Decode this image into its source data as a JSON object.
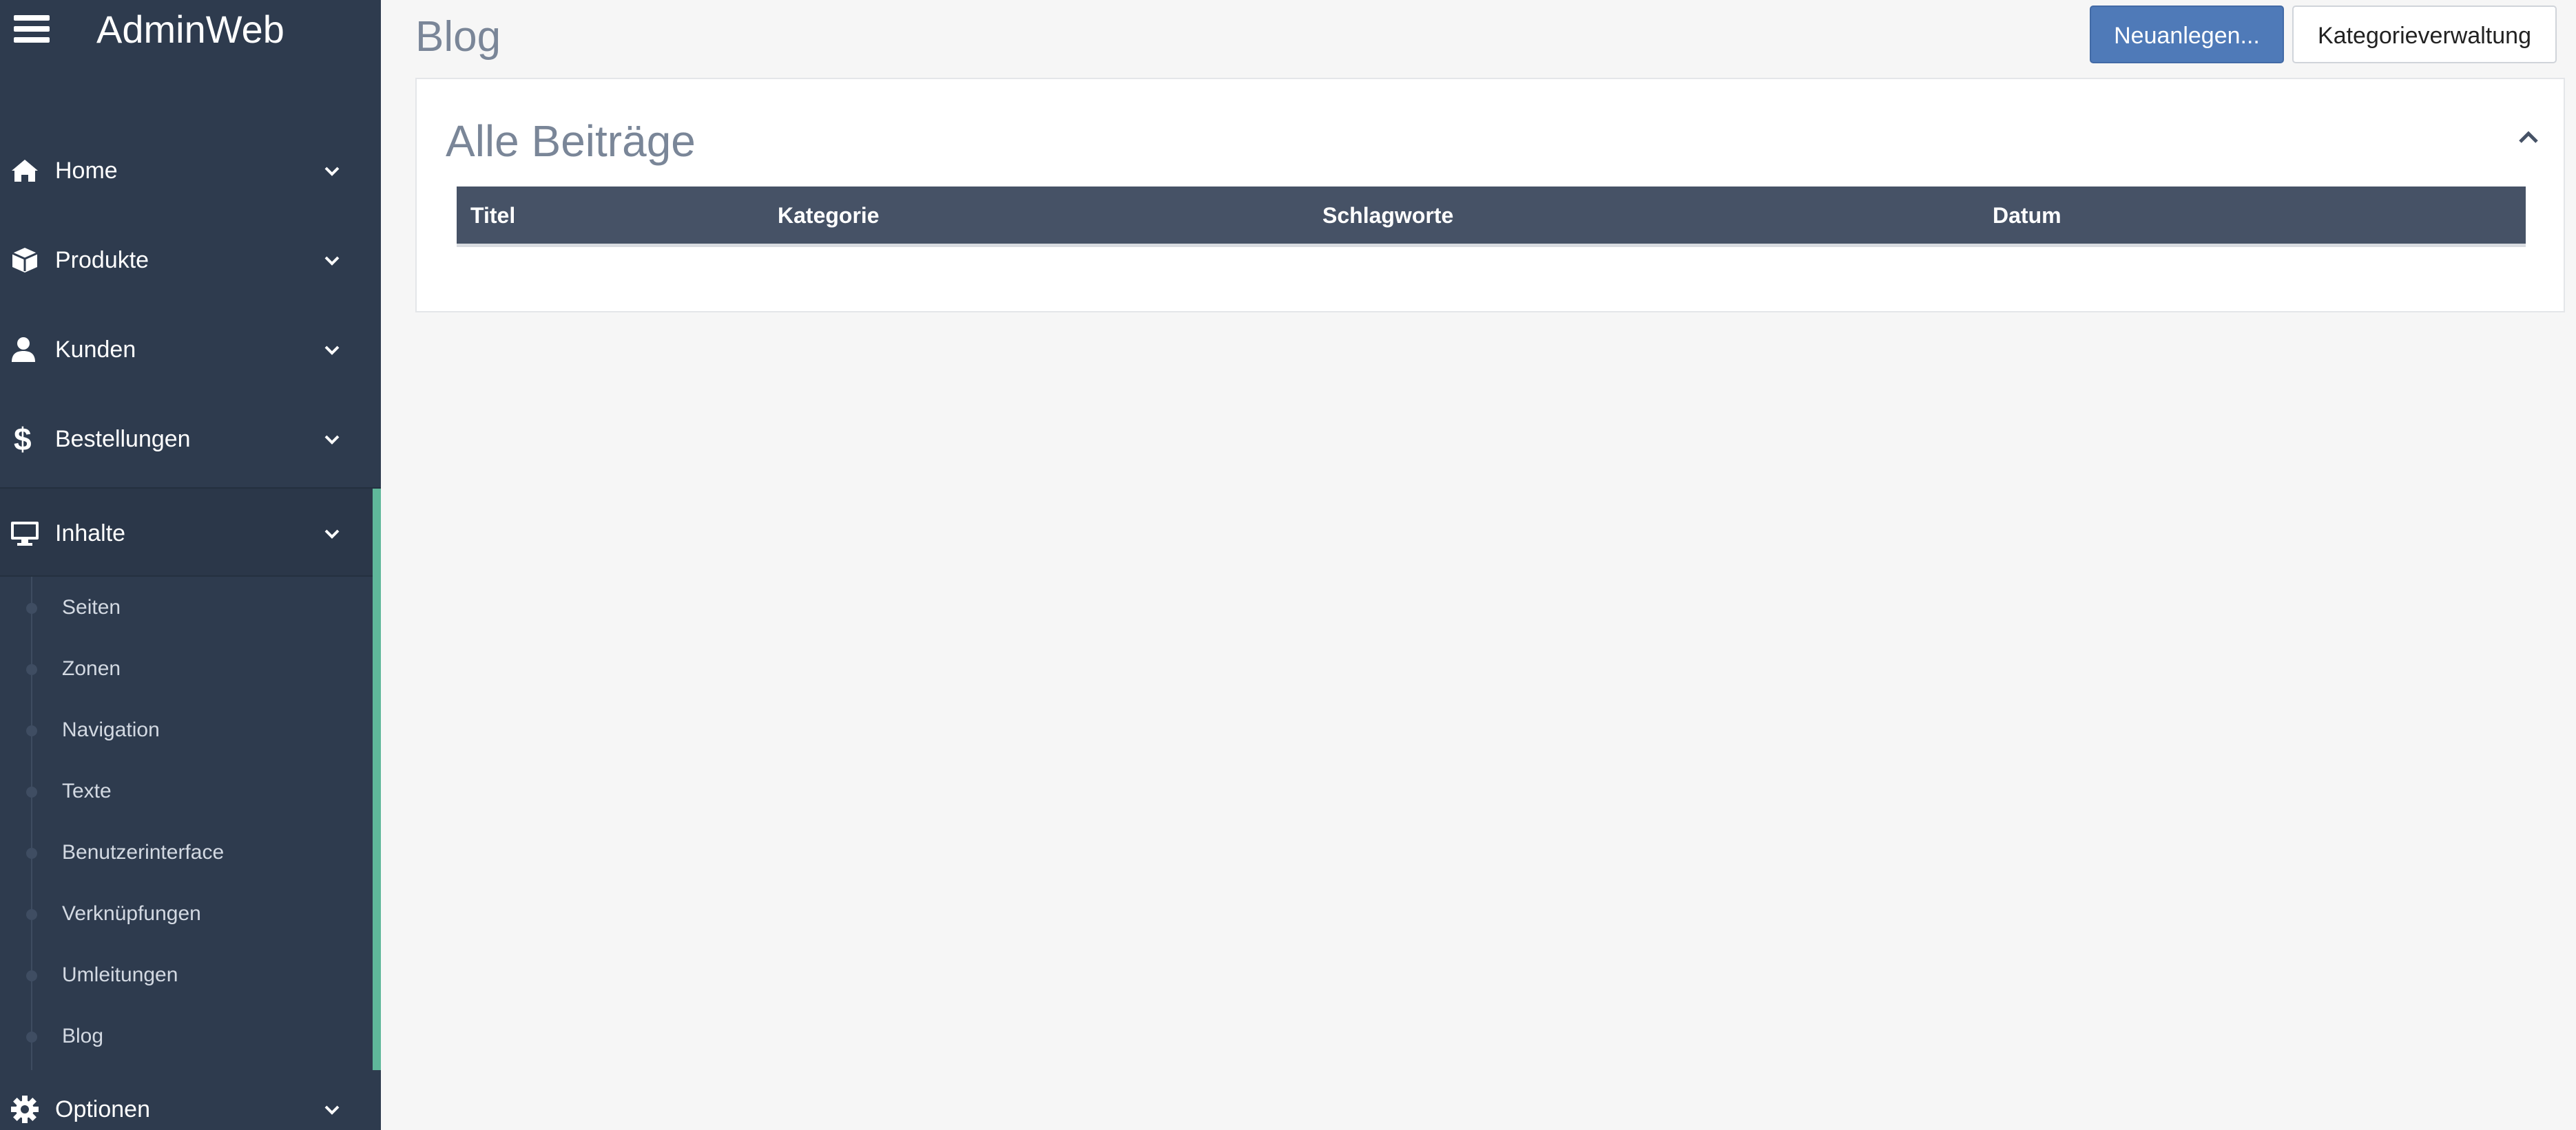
{
  "app": {
    "brand": "AdminWeb"
  },
  "sidebar": {
    "items": [
      {
        "label": "Home",
        "icon": "home-icon"
      },
      {
        "label": "Produkte",
        "icon": "box-icon"
      },
      {
        "label": "Kunden",
        "icon": "user-icon"
      },
      {
        "label": "Bestellungen",
        "icon": "dollar-icon"
      },
      {
        "label": "Inhalte",
        "icon": "monitor-icon",
        "active": true
      },
      {
        "label": "Optionen",
        "icon": "gear-icon"
      }
    ],
    "submenu": [
      {
        "label": "Seiten"
      },
      {
        "label": "Zonen"
      },
      {
        "label": "Navigation"
      },
      {
        "label": "Texte"
      },
      {
        "label": "Benutzerinterface"
      },
      {
        "label": "Verknüpfungen"
      },
      {
        "label": "Umleitungen"
      },
      {
        "label": "Blog"
      }
    ],
    "active_color": "#5fb79a"
  },
  "main": {
    "page_title": "Blog",
    "buttons": {
      "new": "Neuanlegen...",
      "categories": "Kategorieverwaltung"
    },
    "panel": {
      "title": "Alle Beiträge",
      "columns": [
        "Titel",
        "Kategorie",
        "Schlagworte",
        "Datum"
      ],
      "rows": []
    }
  },
  "colors": {
    "sidebar_bg": "#2e3b4e",
    "primary": "#4f7ab8",
    "table_header": "#465266",
    "accent_active": "#5fb79a"
  }
}
